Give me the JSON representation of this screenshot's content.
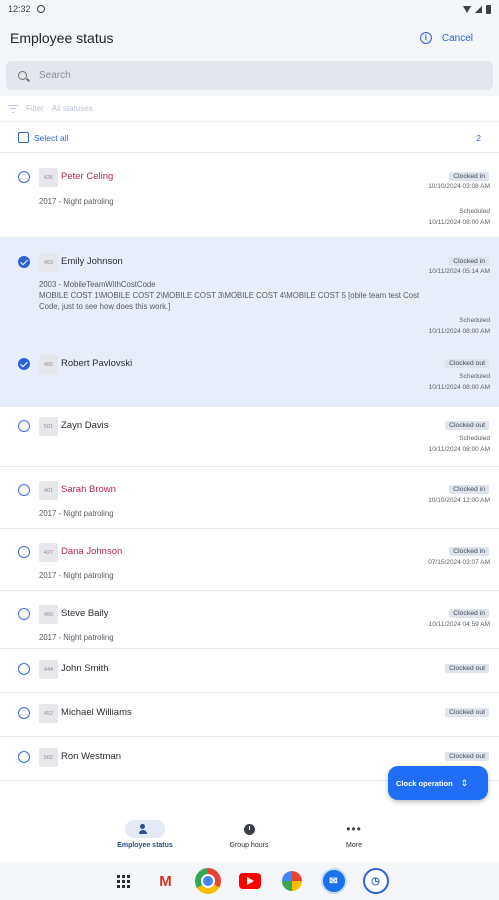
{
  "status_bar": {
    "time": "12:32"
  },
  "header": {
    "title": "Employee status",
    "cancel_label": "Cancel",
    "info_icon": "info-icon"
  },
  "search": {
    "placeholder": "Search"
  },
  "filter": {
    "label": "Filter",
    "value": "All statuses"
  },
  "select_all": {
    "label": "Select all",
    "count": "2"
  },
  "employees": [
    {
      "id": "426",
      "name": "Peter Celing",
      "name_color": "#b5284f",
      "selected": false,
      "detail": "2017 - Night patroling",
      "status": "Clocked in",
      "status_time": "10/10/2024 03:08 AM",
      "scheduled_label": "Scheduled",
      "scheduled_time": "10/11/2024 08:00 AM"
    },
    {
      "id": "453",
      "name": "Emily Johnson",
      "name_color": "#2a2d33",
      "selected": true,
      "detail": "2003 - MobileTeamWithCostCode\nMOBILE COST 1\\MOBILE COST 2\\MOBILE COST 3\\MOBILE COST 4\\MOBILE COST 5 [obile team test Cost Code, just to see how does this work.]",
      "status": "Clocked in",
      "status_time": "10/11/2024 05:14 AM",
      "scheduled_label": "Scheduled",
      "scheduled_time": "10/11/2024 08:00 AM"
    },
    {
      "id": "455",
      "name": "Robert Pavlovski",
      "name_color": "#2a2d33",
      "selected": true,
      "detail": "",
      "status": "Clocked out",
      "status_time": "",
      "scheduled_label": "Scheduled",
      "scheduled_time": "10/11/2024 08:00 AM"
    },
    {
      "id": "501",
      "name": "Zayn Davis",
      "name_color": "#2a2d33",
      "selected": false,
      "detail": "",
      "status": "Clocked out",
      "status_time": "",
      "scheduled_label": "Scheduled",
      "scheduled_time": "10/11/2024 08:00 AM"
    },
    {
      "id": "401",
      "name": "Sarah Brown",
      "name_color": "#b5284f",
      "selected": false,
      "detail": "2017 - Night patroling",
      "status": "Clocked in",
      "status_time": "10/10/2024 12:00 AM",
      "scheduled_label": "",
      "scheduled_time": ""
    },
    {
      "id": "427",
      "name": "Dana Johnson",
      "name_color": "#b5284f",
      "selected": false,
      "detail": "2017 - Night patroling",
      "status": "Clocked in",
      "status_time": "07/15/2024 03:07 AM",
      "scheduled_label": "",
      "scheduled_time": ""
    },
    {
      "id": "450",
      "name": "Steve Baily",
      "name_color": "#2a2d33",
      "selected": false,
      "detail": "2017 - Night patroling",
      "status": "Clocked in",
      "status_time": "10/11/2024 04:59 AM",
      "scheduled_label": "",
      "scheduled_time": ""
    },
    {
      "id": "444",
      "name": "John Smith",
      "name_color": "#2a2d33",
      "selected": false,
      "detail": "",
      "status": "Clocked out",
      "status_time": "",
      "scheduled_label": "",
      "scheduled_time": ""
    },
    {
      "id": "452",
      "name": "Michael Williams",
      "name_color": "#2a2d33",
      "selected": false,
      "detail": "",
      "status": "Clocked out",
      "status_time": "",
      "scheduled_label": "",
      "scheduled_time": ""
    },
    {
      "id": "502",
      "name": "Ron Westman",
      "name_color": "#2a2d33",
      "selected": false,
      "detail": "",
      "status": "Clocked out",
      "status_time": "",
      "scheduled_label": "",
      "scheduled_time": ""
    }
  ],
  "fab": {
    "label": "Clock operation",
    "icon": "swap-vertical-icon"
  },
  "bottom_nav": [
    {
      "label": "Employee status",
      "icon": "people-icon",
      "active": true
    },
    {
      "label": "Group hours",
      "icon": "clock-icon",
      "active": false
    },
    {
      "label": "More",
      "icon": "more-dots-icon",
      "active": false
    }
  ],
  "dock": [
    "apps-grid-icon",
    "gmail-icon",
    "chrome-icon",
    "youtube-icon",
    "photos-icon",
    "messages-icon",
    "clock-app-icon"
  ],
  "colors": {
    "accent": "#2d63d8",
    "fab": "#1f6ef5",
    "selected_row": "#e8eef9",
    "red_name": "#b5284f"
  }
}
